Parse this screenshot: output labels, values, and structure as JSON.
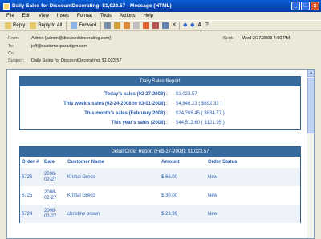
{
  "window": {
    "title": "Daily Sales for DiscountDecorating: $1,023.57 - Message (HTML)",
    "controls": [
      "_",
      "□",
      "x"
    ]
  },
  "menu": [
    "File",
    "Edit",
    "View",
    "Insert",
    "Format",
    "Tools",
    "Actions",
    "Help"
  ],
  "toolbar": {
    "reply": "Reply",
    "reply_all": "Reply to All",
    "forward": "Forward"
  },
  "header": {
    "from_label": "From:",
    "from": "Admin [admin@discountdecorating.com]",
    "to_label": "To:",
    "to": "jeff@customerparadigm.com",
    "cc_label": "Cc:",
    "cc": "",
    "subject_label": "Subject:",
    "subject": "Daily Sales for DiscountDecorating: $1,023.57",
    "sent_label": "Sent:",
    "sent": "Wed 2/27/2008 4:00 PM"
  },
  "sales_report": {
    "title": "Daily Sales Report",
    "rows": [
      {
        "label": "Today's sales (02-27-2008) :",
        "value": "$1,023.57"
      },
      {
        "label": "This week's sales (02-24-2008 to 03-01-2008) :",
        "value": "$4,846.23 ( $692.32 )"
      },
      {
        "label": "This month's sales (February 2008) :",
        "value": "$24,208.45 ( $834.77 )"
      },
      {
        "label": "This year's sales (2008) :",
        "value": "$44,512.60 ( $121.95 )"
      }
    ]
  },
  "order_report": {
    "title": "Detail Order Report (Feb-27-2008): $1,023.57",
    "columns": [
      "Order #",
      "Date",
      "Customer Name",
      "Amount",
      "Order Status"
    ],
    "rows": [
      {
        "order": "6726",
        "date1": "2008-",
        "date2": "02-27",
        "name": "Kristal Greco",
        "amount": "$ 66.00",
        "status": "New"
      },
      {
        "order": "6725",
        "date1": "2008-",
        "date2": "02-27",
        "name": "Kristal Greco",
        "amount": "$ 30.00",
        "status": "New"
      },
      {
        "order": "6724",
        "date1": "2008-",
        "date2": "02-27",
        "name": "christine brown",
        "amount": "$ 23.99",
        "status": "New"
      }
    ]
  },
  "colors": {
    "titlebar": "#0746b3",
    "report_header": "#376a9e",
    "link_text": "#2a5db0"
  }
}
